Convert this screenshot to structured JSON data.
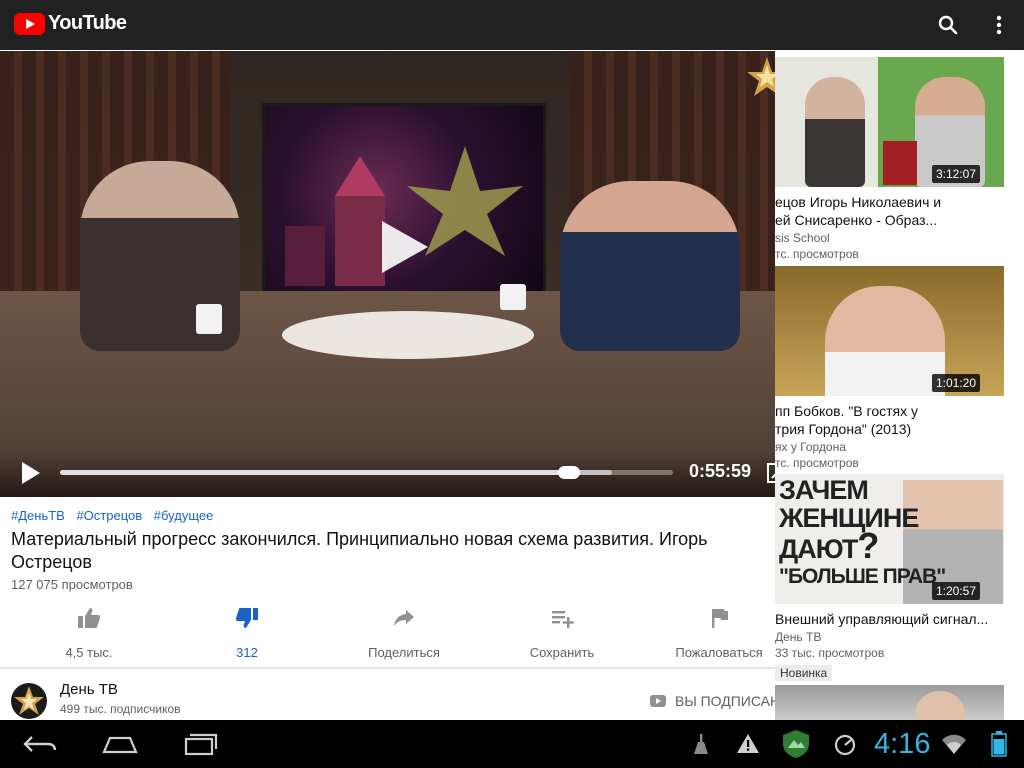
{
  "app": {
    "brand": "YouTube"
  },
  "colors": {
    "accent_red": "#ff0000",
    "link_blue": "#1a63c4",
    "clock_blue": "#33b5e5",
    "topbar": "#212121"
  },
  "topbar": {
    "icons": [
      "search-icon",
      "more-vert-icon"
    ]
  },
  "player": {
    "time": "0:55:59",
    "progress_fraction": 0.83,
    "buffer_fraction": 0.9
  },
  "video": {
    "tags": [
      "#ДеньТВ",
      "#Острецов",
      "#будущее"
    ],
    "title": "Материальный прогресс закончился. Принципиально новая схема развития. Игорь Острецов",
    "views": "127 075 просмотров",
    "actions": {
      "like": "4,5 тыс.",
      "dislike": "312",
      "share": "Поделиться",
      "save": "Сохранить",
      "report": "Пожаловаться"
    }
  },
  "channel": {
    "name": "День ТВ",
    "subscribers": "499 тыс. подписчиков",
    "subscribed_label": "ВЫ ПОДПИСАНЫ"
  },
  "related": [
    {
      "title_line1": "ецов Игорь Николаевич и",
      "title_line2": "ей Снисаренко - Образ...",
      "channel": "sis School",
      "views": "тс. просмотров",
      "duration": "3:12:07"
    },
    {
      "title_line1": "пп Бобков. \"В гостях у",
      "title_line2": "трия Гордона\" (2013)",
      "channel": "ях у Гордона",
      "views": "тс. просмотров",
      "duration": "1:01:20"
    },
    {
      "title_line1": "Внешний управляющий сигнал...",
      "channel": "День ТВ",
      "views": "33 тыс. просмотров",
      "badge": "Новинка",
      "duration": "1:20:57",
      "thumb_caption": [
        "ЗАЧЕМ",
        "ЖЕНЩИНЕ",
        "ДАЮТ",
        "\"БОЛЬШЕ ПРАВ\"",
        "?"
      ]
    }
  ],
  "system": {
    "clock": "4:16"
  }
}
